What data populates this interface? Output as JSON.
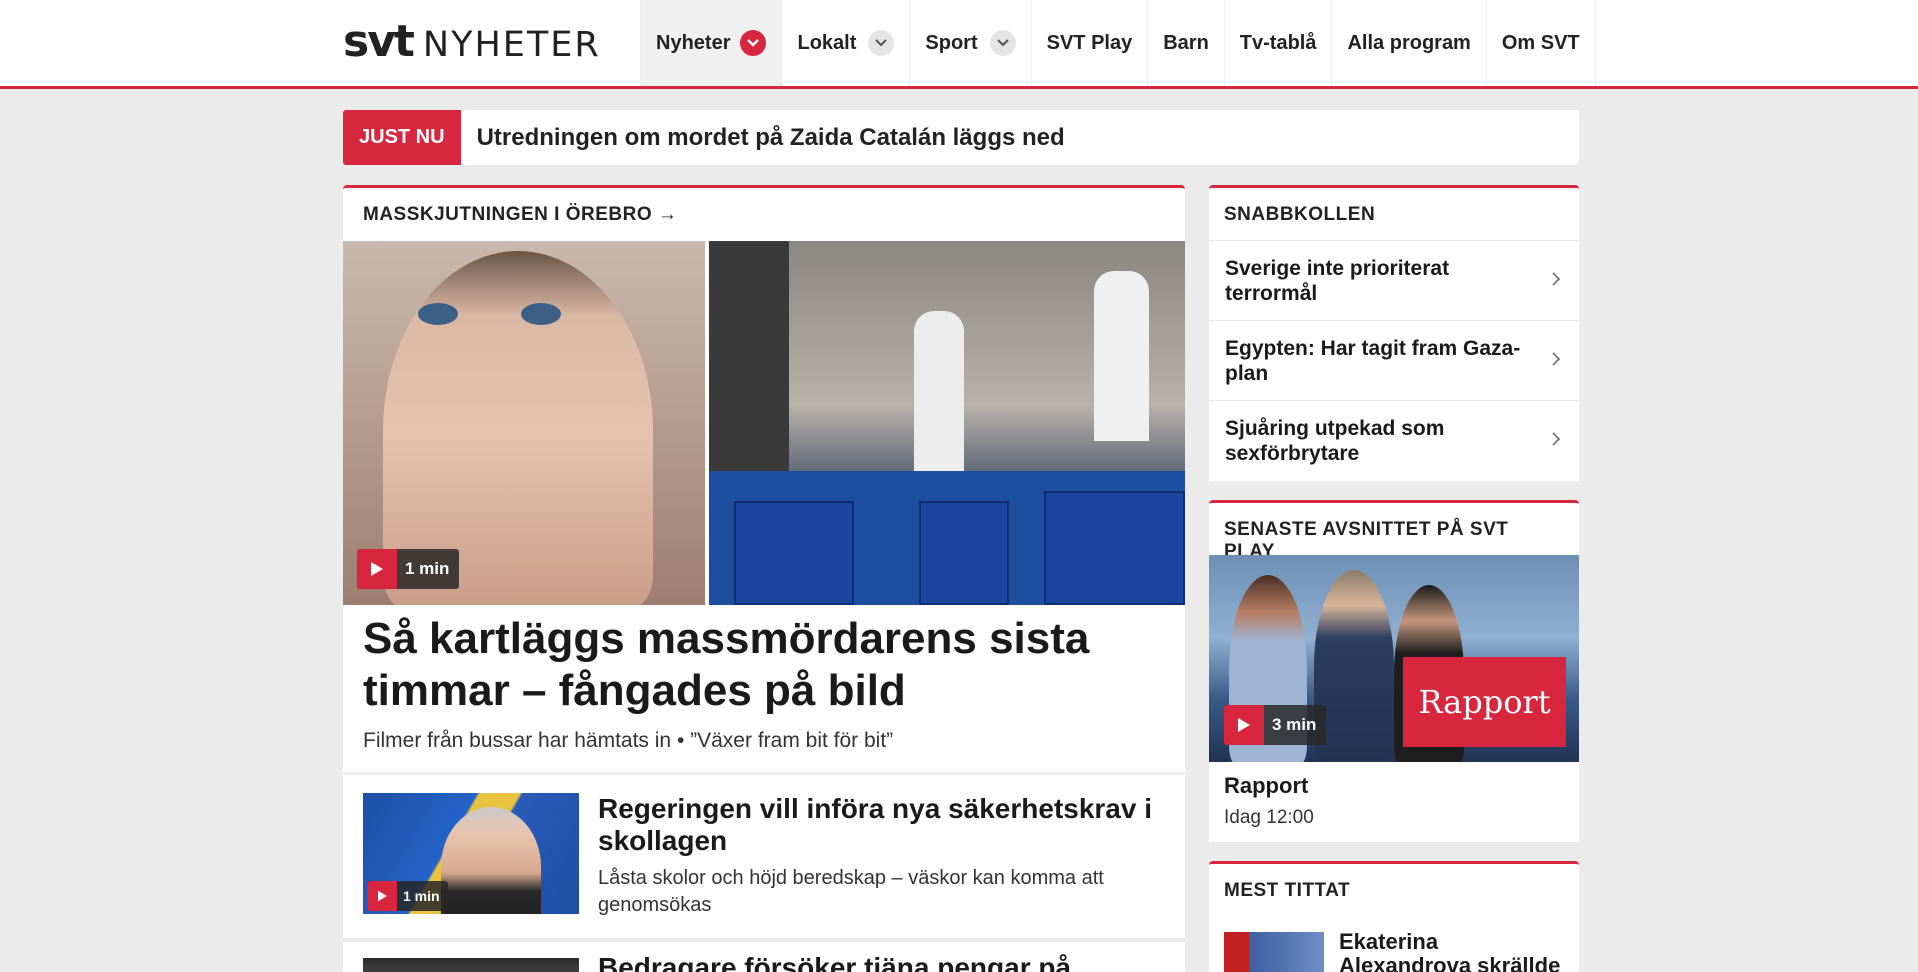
{
  "header": {
    "logo_svt": "svt",
    "logo_nyheter": "NYHETER",
    "nav": [
      {
        "label": "Nyheter"
      },
      {
        "label": "Lokalt"
      },
      {
        "label": "Sport"
      },
      {
        "label": "SVT Play"
      },
      {
        "label": "Barn"
      },
      {
        "label": "Tv-tablå"
      },
      {
        "label": "Alla program"
      },
      {
        "label": "Om SVT"
      }
    ],
    "accent_color": "#d7263d"
  },
  "justnu": {
    "tag": "JUST NU",
    "text": "Utredningen om mordet på Zaida Catalán läggs ned"
  },
  "main": {
    "section": "MASSKJUTNINGEN I ÖREBRO →",
    "hero_video_duration": "1 min",
    "hero_title": "Så kartläggs massmördarens sista timmar – fångades på bild",
    "hero_sub": "Filmer från bussar har hämtats in • ”Växer fram bit för bit”",
    "story": {
      "title": "Regeringen vill införa nya säkerhetskrav i skollagen",
      "text": "Låsta skolor och höjd beredskap – väskor kan komma att genomsökas",
      "video_duration": "1 min"
    },
    "story2": {
      "title": "Bedragare försöker tjäna pengar på"
    }
  },
  "snabbkollen": {
    "heading": "SNABBKOLLEN",
    "items": [
      {
        "label": "Sverige inte prioriterat terrormål"
      },
      {
        "label": "Egypten: Har tagit fram Gaza-plan"
      },
      {
        "label": "Sjuåring utpekad som sexförbrytare"
      }
    ]
  },
  "svtplay": {
    "heading": "SENASTE AVSNITTET PÅ SVT PLAY",
    "logo_text": "Rapport",
    "video_duration": "3 min",
    "title": "Rapport",
    "time": "Idag 12:00"
  },
  "mest_tittat": {
    "heading": "MEST TITTAT",
    "item_title": "Ekaterina Alexandrova skrällde"
  }
}
